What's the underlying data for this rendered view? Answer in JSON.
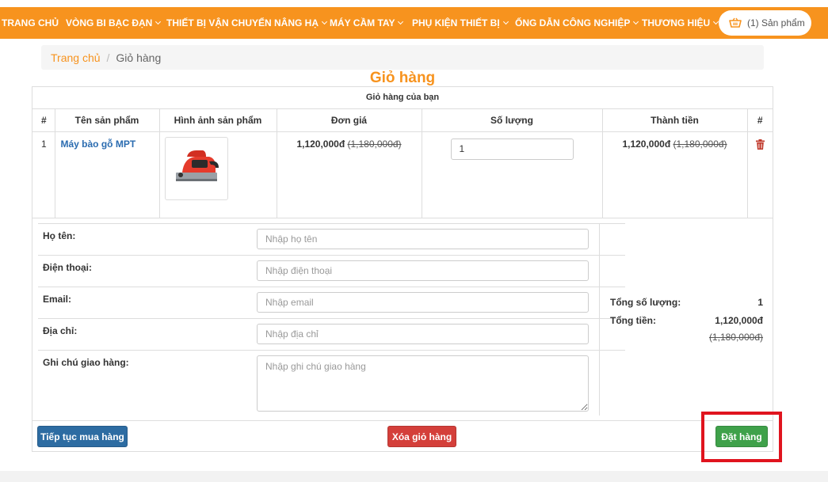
{
  "nav": {
    "items": [
      {
        "label": "TRANG CHỦ",
        "dropdown": false
      },
      {
        "label": "VÒNG BI BẠC ĐẠN",
        "dropdown": true
      },
      {
        "label": "THIẾT BỊ VẬN CHUYỂN NÂNG HẠ",
        "dropdown": true
      },
      {
        "label": "MÁY CẦM TAY",
        "dropdown": true
      },
      {
        "label": "PHỤ KIỆN THIẾT BỊ",
        "dropdown": true
      },
      {
        "label": "ỐNG DẪN CÔNG NGHIỆP",
        "dropdown": true
      },
      {
        "label": "THƯƠNG HIỆU",
        "dropdown": true
      }
    ],
    "cart_label": "(1) Sản phẩm"
  },
  "breadcrumb": {
    "home": "Trang chủ",
    "separator": "/",
    "current": "Giỏ hàng"
  },
  "page_title": "Giỏ hàng",
  "cart": {
    "heading": "Giỏ hàng của bạn",
    "columns": {
      "num": "#",
      "name": "Tên sản phẩm",
      "image": "Hình ảnh sản phẩm",
      "unit_price": "Đơn giá",
      "quantity": "Số lượng",
      "total": "Thành tiền",
      "action": "#"
    },
    "rows": [
      {
        "num": "1",
        "name": "Máy bào gỗ MPT",
        "price": "1,120,000đ",
        "old_price": "(1,180,000đ)",
        "quantity": "1",
        "total": "1,120,000đ",
        "old_total": "(1,180,000đ)"
      }
    ]
  },
  "form": {
    "name_label": "Họ tên:",
    "name_placeholder": "Nhập họ tên",
    "phone_label": "Điện thoại:",
    "phone_placeholder": "Nhập điện thoại",
    "email_label": "Email:",
    "email_placeholder": "Nhập email",
    "address_label": "Địa chỉ:",
    "address_placeholder": "Nhập địa chỉ",
    "note_label": "Ghi chú giao hàng:",
    "note_placeholder": "Nhập ghi chú giao hàng"
  },
  "totals": {
    "qty_label": "Tổng số lượng:",
    "qty_value": "1",
    "money_label": "Tổng tiền:",
    "money_value": "1,120,000đ",
    "money_old": "(1,180,000đ)"
  },
  "buttons": {
    "continue": "Tiếp tục mua hàng",
    "clear": "Xóa giỏ hàng",
    "order": "Đặt hàng"
  },
  "colors": {
    "accent": "#f7931e",
    "link": "#2b6cb0",
    "primary_button": "#2d6ca2",
    "danger_button": "#d43f3a",
    "success_button": "#3fa14a",
    "highlight": "#e0141e"
  }
}
